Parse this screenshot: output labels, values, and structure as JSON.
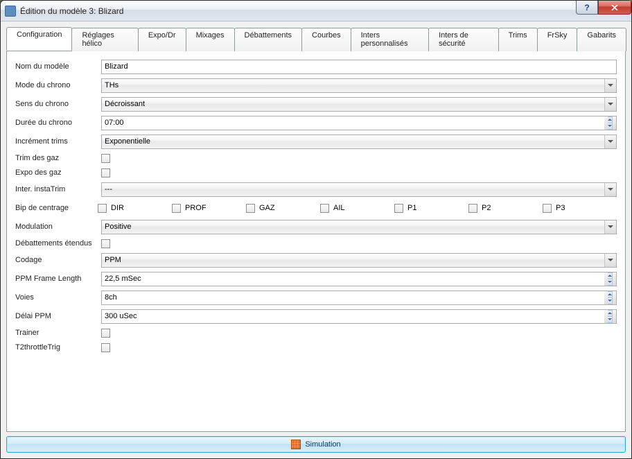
{
  "window": {
    "title": "Édition du modèle 3: Blizard"
  },
  "tabs": [
    {
      "label": "Configuration"
    },
    {
      "label": "Réglages hélico"
    },
    {
      "label": "Expo/Dr"
    },
    {
      "label": "Mixages"
    },
    {
      "label": "Débattements"
    },
    {
      "label": "Courbes"
    },
    {
      "label": "Inters personnalisés"
    },
    {
      "label": "Inters de sécurité"
    },
    {
      "label": "Trims"
    },
    {
      "label": "FrSky"
    },
    {
      "label": "Gabarits"
    }
  ],
  "labels": {
    "model_name": "Nom du modèle",
    "timer_mode": "Mode du chrono",
    "timer_dir": "Sens du chrono",
    "timer_dur": "Durée du chrono",
    "trim_inc": "Incrément trims",
    "thr_trim": "Trim des gaz",
    "thr_expo": "Expo des gaz",
    "instatrim": "Inter. instaTrim",
    "center_beep": "Bip de centrage",
    "modulation": "Modulation",
    "ext_limits": "Débattements étendus",
    "encoding": "Codage",
    "ppm_frame": "PPM Frame Length",
    "channels": "Voies",
    "ppm_delay": "Délai PPM",
    "trainer": "Trainer",
    "t2throttle": "T2throttleTrig"
  },
  "values": {
    "model_name": "Blizard",
    "timer_mode": "THs",
    "timer_dir": "Décroissant",
    "timer_dur": "07:00",
    "trim_inc": "Exponentielle",
    "instatrim": "---",
    "modulation": "Positive",
    "encoding": "PPM",
    "ppm_frame": "22,5 mSec",
    "channels": "8ch",
    "ppm_delay": " 300 uSec"
  },
  "center_beep_items": [
    "DIR",
    "PROF",
    "GAZ",
    "AIL",
    "P1",
    "P2",
    "P3"
  ],
  "simulation_label": "Simulation"
}
